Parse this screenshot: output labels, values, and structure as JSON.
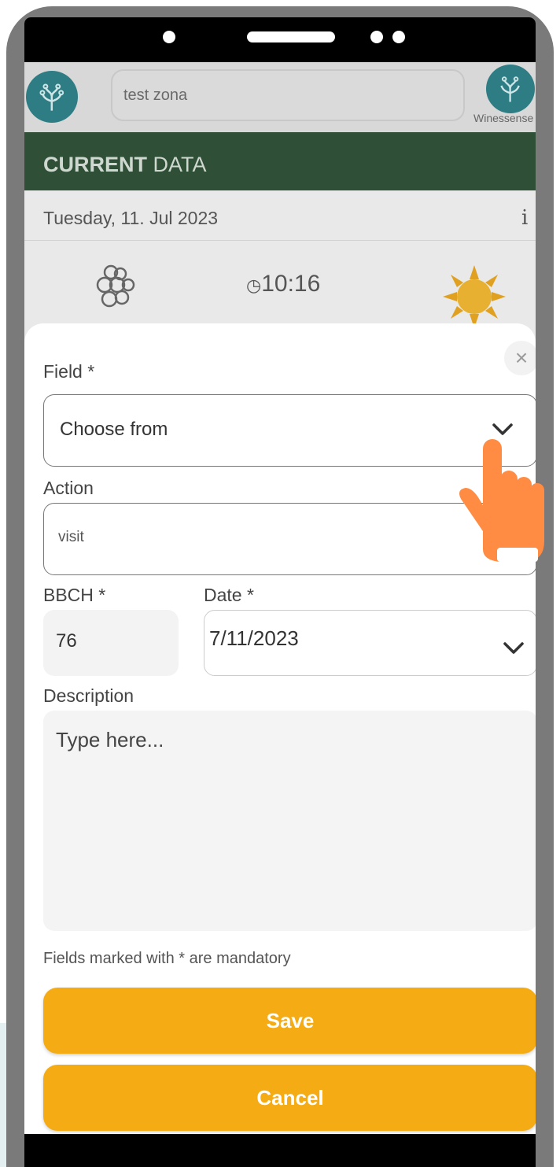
{
  "header": {
    "zone_value": "test zona",
    "brand_label": "Winessense"
  },
  "section": {
    "title_bold": "CURRENT",
    "title_rest": " DATA"
  },
  "current": {
    "date": "Tuesday, 11. Jul 2023",
    "info": "i",
    "time": "⌚10:16",
    "time_display": "ⓤ10:16",
    "disease_icon": "grape-disease-icon",
    "weather_icon": "sun-icon"
  },
  "form": {
    "close_symbol": "×",
    "field_label": "Field *",
    "field_value": "Choose from",
    "action_label": "Action",
    "action_value": "visit",
    "bbch_label": "BBCH *",
    "bbch_value": "76",
    "date_label": "Date *",
    "date_value": "7/11/2023",
    "description_label": "Description",
    "description_placeholder": "Type here...",
    "mandatory_note": "Fields marked with * are mandatory",
    "save_label": "Save",
    "cancel_label": "Cancel"
  },
  "colors": {
    "accent": "#f4ab14",
    "section_bar": "#2f4f36",
    "hand": "#ff8c42",
    "logo": "#2e7d84"
  }
}
